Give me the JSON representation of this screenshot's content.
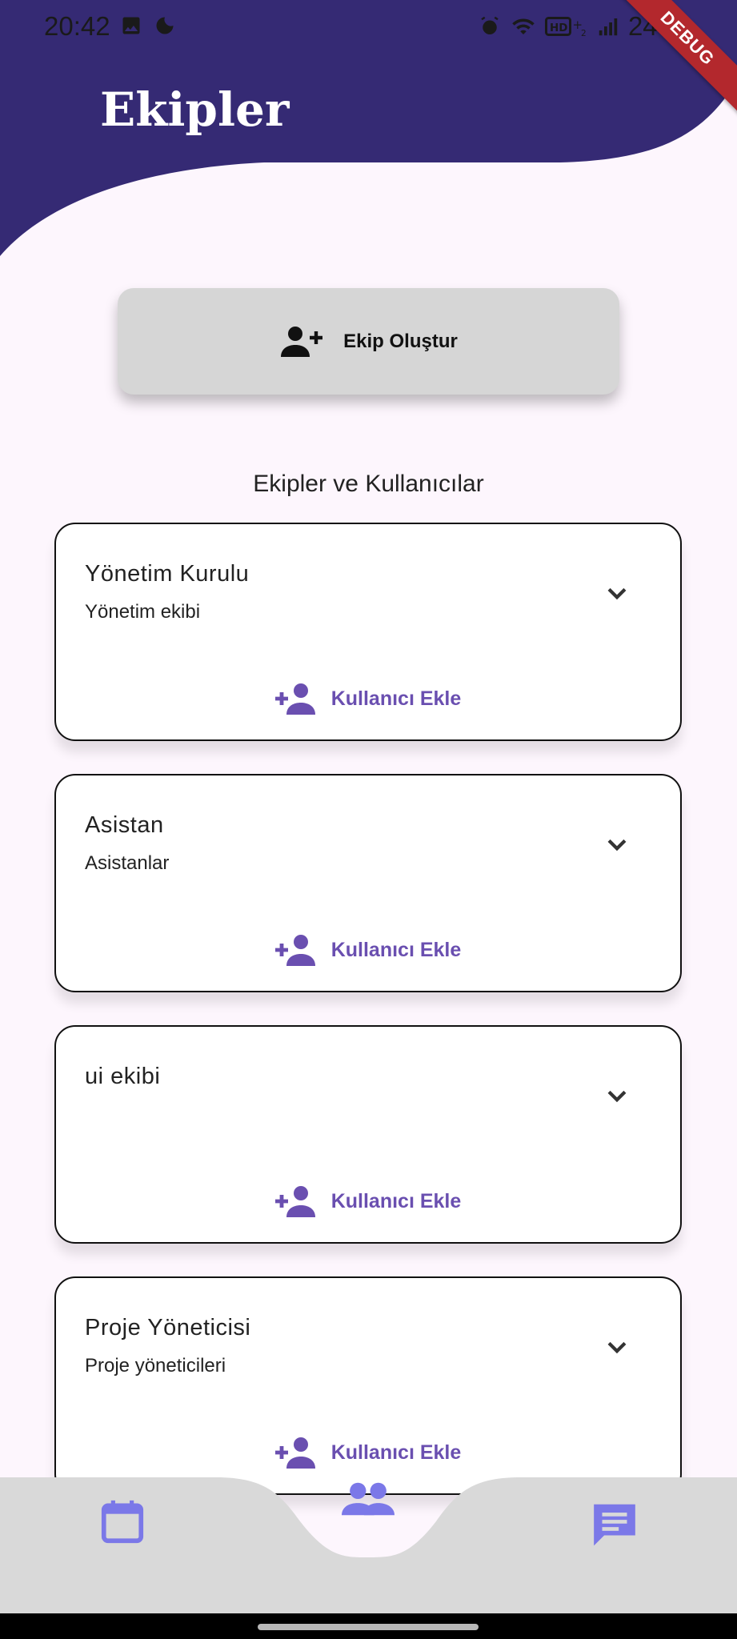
{
  "status_bar": {
    "time": "20:42",
    "battery": "24%",
    "icons_left": [
      "image-icon",
      "moon-icon"
    ],
    "icons_right": [
      "alarm-icon",
      "wifi-icon",
      "hd-signal-icon",
      "cell-signal-icon"
    ]
  },
  "debug_banner": "DEBUG",
  "header": {
    "title": "Ekipler"
  },
  "create_team_button": {
    "label": "Ekip Oluştur",
    "icon": "person-add-icon"
  },
  "section_title": "Ekipler ve Kullanıcılar",
  "teams": [
    {
      "name": "Yönetim Kurulu",
      "description": "Yönetim ekibi",
      "add_user_label": "Kullanıcı Ekle"
    },
    {
      "name": "Asistan",
      "description": "Asistanlar",
      "add_user_label": "Kullanıcı Ekle"
    },
    {
      "name": "ui ekibi",
      "description": "",
      "add_user_label": "Kullanıcı Ekle"
    },
    {
      "name": "Proje Yöneticisi",
      "description": "Proje yöneticileri",
      "add_user_label": "Kullanıcı Ekle"
    }
  ],
  "bottom_nav": {
    "items": [
      {
        "icon": "calendar-icon",
        "active": false
      },
      {
        "icon": "group-icon",
        "active": true
      },
      {
        "icon": "chat-icon",
        "active": false
      }
    ]
  },
  "colors": {
    "header": "#352a74",
    "background": "#fdf6fd",
    "accent": "#6a4fb0",
    "nav_icon": "#7b78e8",
    "nav_background": "#d9d9d9"
  }
}
